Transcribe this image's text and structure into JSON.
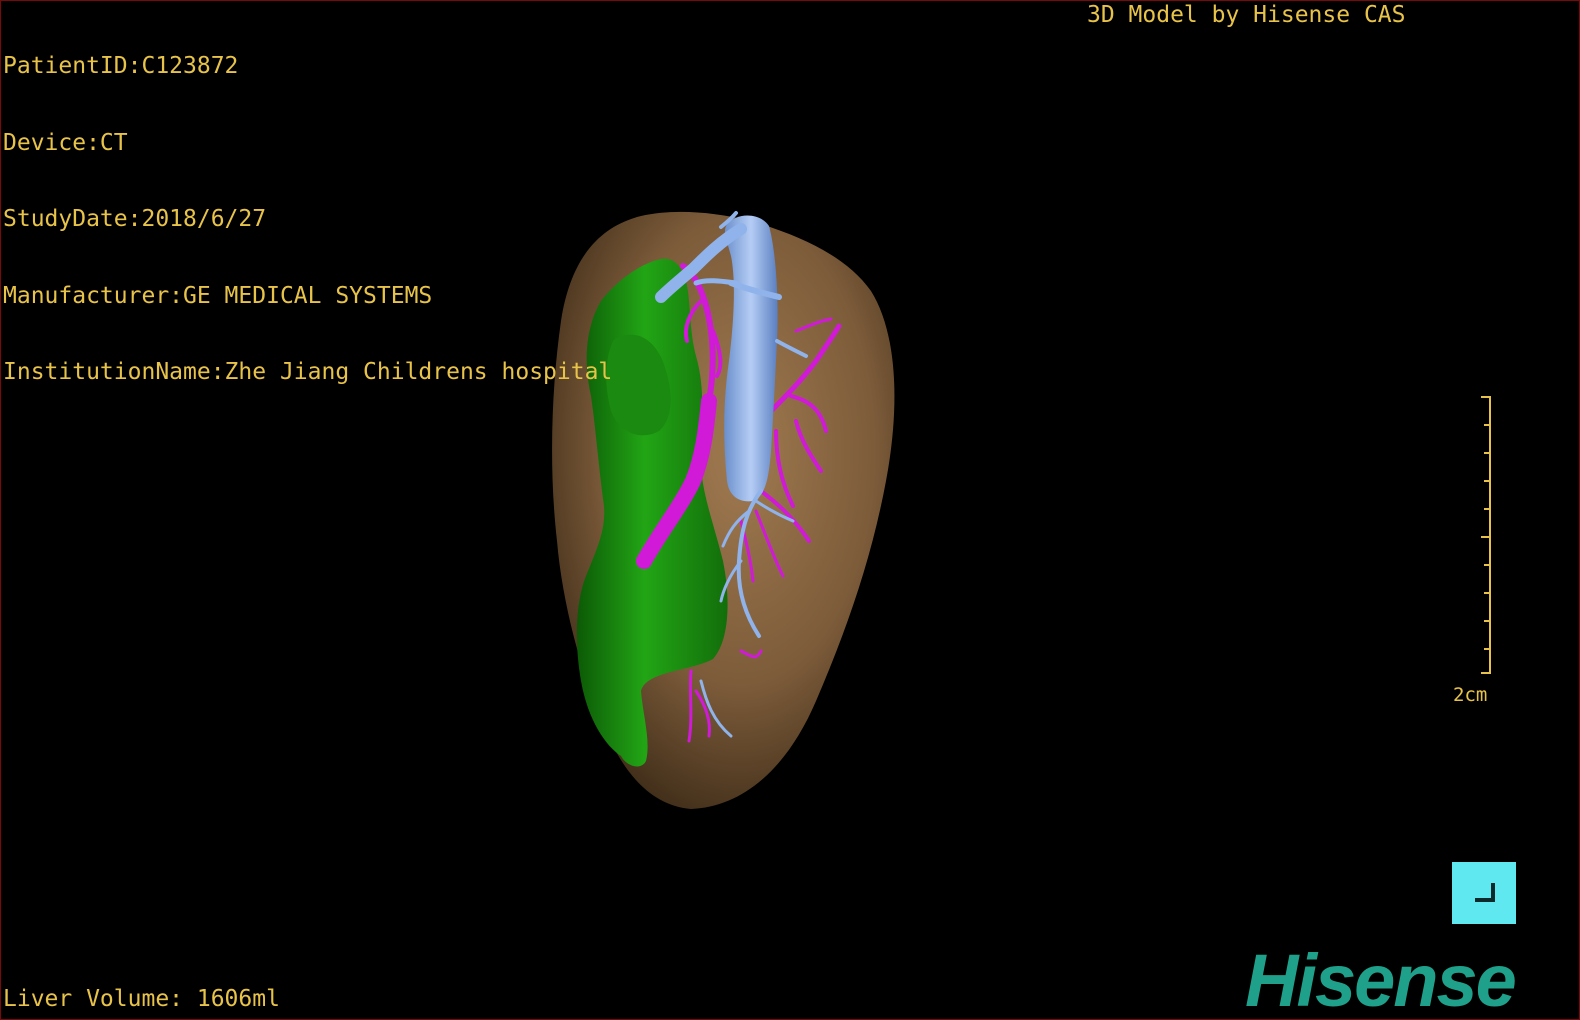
{
  "overlay": {
    "patient_id": "PatientID:C123872",
    "device": "Device:CT",
    "study_date": "StudyDate:2018/6/27",
    "manufacturer": "Manufacturer:GE MEDICAL SYSTEMS",
    "institution": "InstitutionName:Zhe Jiang Childrens hospital",
    "credit": "3D Model by Hisense CAS",
    "liver_volume": "Liver Volume: 1606ml"
  },
  "scale_bar": {
    "label": "2cm"
  },
  "brand": {
    "logo_text": "Hisense",
    "color": "#1fa08a"
  },
  "orientation_button": {
    "icon": "corner-bracket-icon",
    "color": "#5fe8f0"
  },
  "model_colors": {
    "liver": "#7d5c3a",
    "green_structure": "#1e9a12",
    "portal_vein": "#8fb3ea",
    "hepatic_artery": "#d01ad8"
  }
}
